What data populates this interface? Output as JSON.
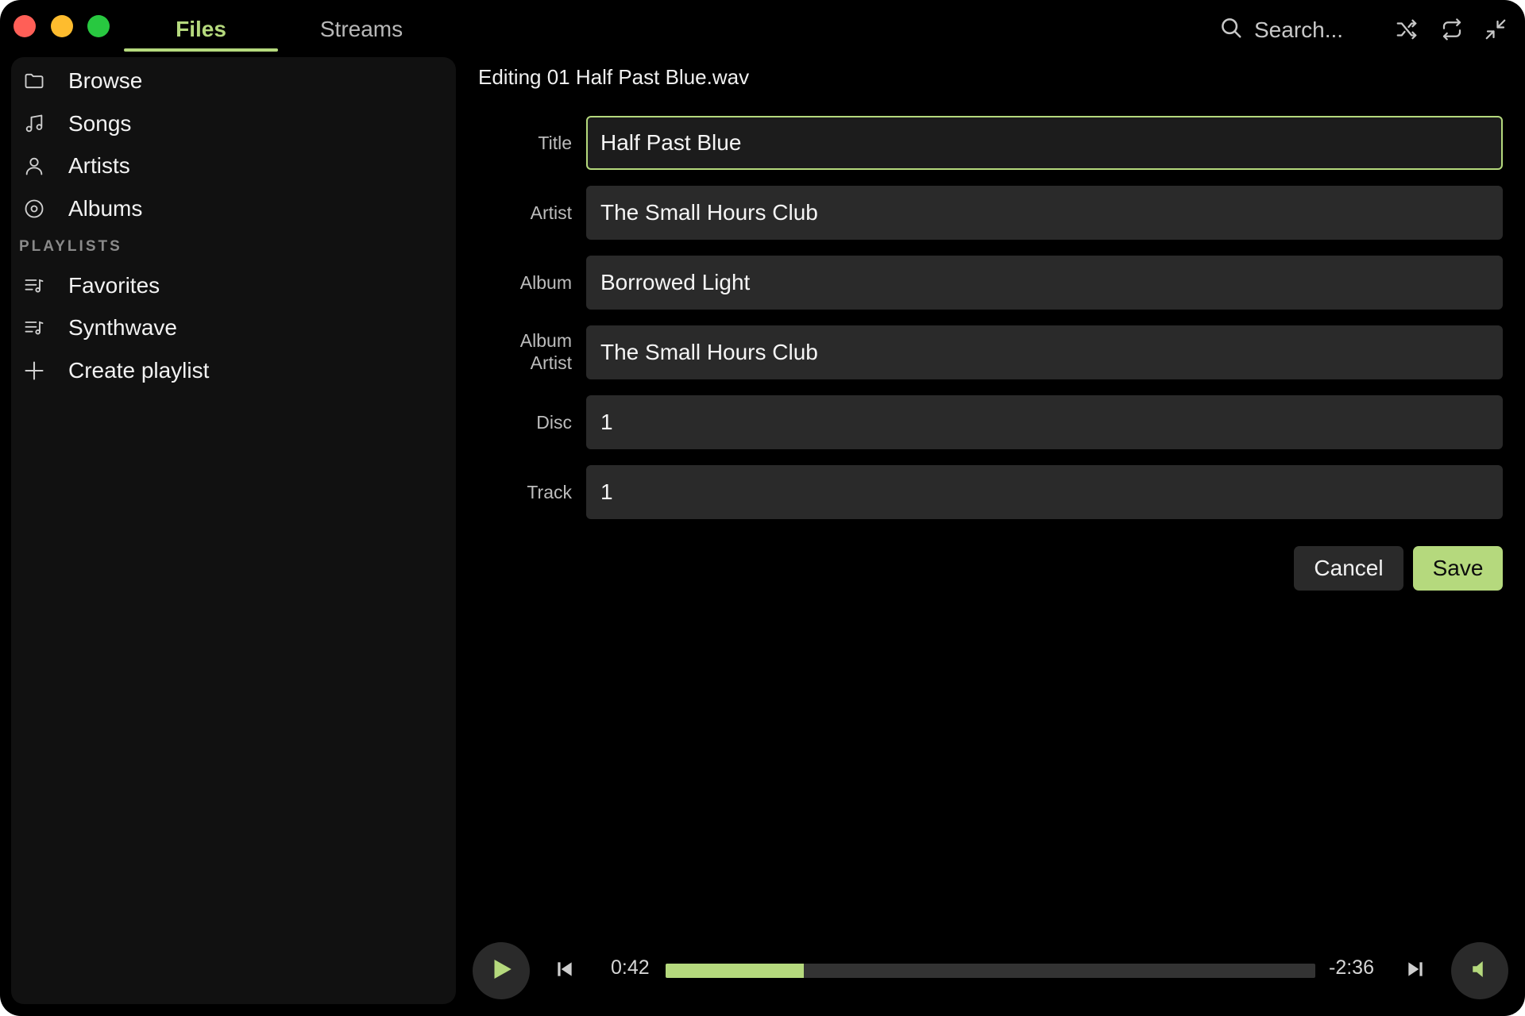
{
  "tabs": [
    {
      "label": "Files",
      "active": true
    },
    {
      "label": "Streams",
      "active": false
    }
  ],
  "search": {
    "placeholder": "Search...",
    "icon": "search-icon"
  },
  "toolbar_icons": [
    "shuffle-icon",
    "repeat-icon",
    "minimize-icon"
  ],
  "sidebar": {
    "items": [
      {
        "label": "Browse",
        "icon": "folder-icon"
      },
      {
        "label": "Songs",
        "icon": "music-note-icon"
      },
      {
        "label": "Artists",
        "icon": "person-icon"
      },
      {
        "label": "Albums",
        "icon": "disc-icon"
      }
    ],
    "playlists_heading": "PLAYLISTS",
    "playlists": [
      {
        "label": "Favorites",
        "icon": "playlist-icon"
      },
      {
        "label": "Synthwave",
        "icon": "playlist-icon"
      }
    ],
    "create_label": "Create playlist"
  },
  "editor": {
    "heading": "Editing 01 Half Past Blue.wav",
    "fields": [
      {
        "label": "Title",
        "value": "Half Past Blue"
      },
      {
        "label": "Artist",
        "value": "The Small Hours Club"
      },
      {
        "label": "Album",
        "value": "Borrowed Light"
      },
      {
        "label": "Album Artist",
        "value": "The Small Hours Club"
      },
      {
        "label": "Disc",
        "value": "1"
      },
      {
        "label": "Track",
        "value": "1"
      }
    ],
    "cancel_label": "Cancel",
    "save_label": "Save"
  },
  "player": {
    "elapsed": "0:42",
    "remaining": "-2:36",
    "progress": 0.213
  },
  "colors": {
    "accent": "#b5d97d",
    "background": "#000000",
    "sidebar": "#111111",
    "field": "#2a2a2a"
  }
}
